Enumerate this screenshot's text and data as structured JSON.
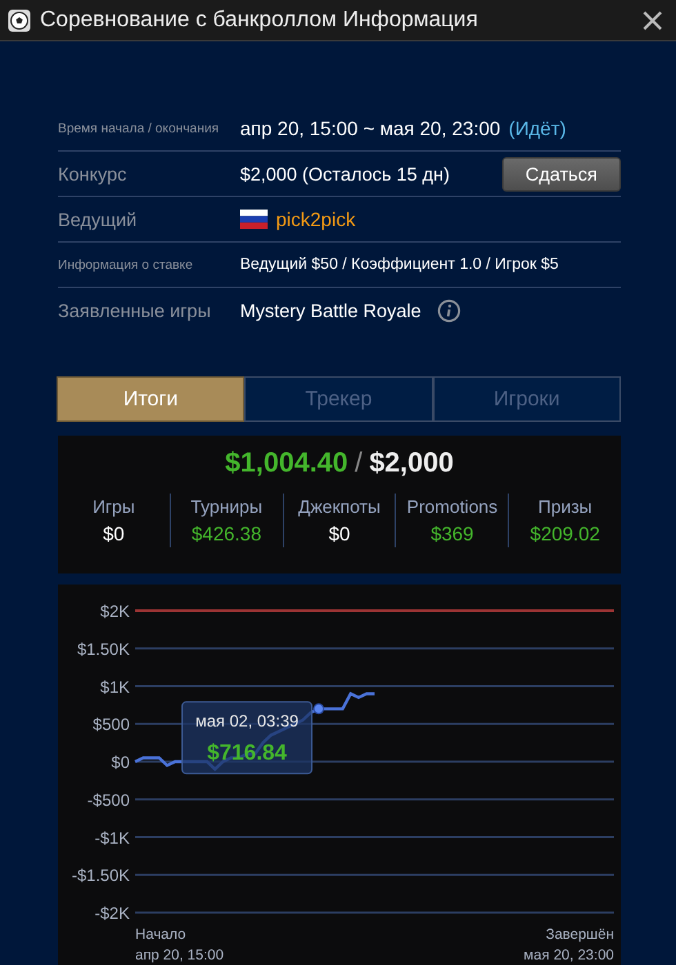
{
  "window": {
    "title": "Соревнование с банкроллом Информация"
  },
  "info": [
    {
      "kind": "time",
      "label": "Время начала / окончания",
      "value": "апр 20, 15:00 ~ мая 20, 23:00",
      "status": "(Идёт)"
    },
    {
      "kind": "prize",
      "label": "Конкурс",
      "value": "$2,000 (Осталось 15 дн)",
      "button": "Сдаться"
    },
    {
      "kind": "host",
      "label": "Ведущий",
      "value": "pick2pick"
    },
    {
      "kind": "text",
      "label": "Информация о ставке",
      "value": "Ведущий $50 / Коэффициент 1.0 / Игрок $5"
    },
    {
      "kind": "games",
      "label": "Заявленные игры",
      "value": "Mystery Battle Royale"
    }
  ],
  "tabs": [
    {
      "label": "Итоги",
      "selected": true
    },
    {
      "label": "Трекер",
      "selected": false
    },
    {
      "label": "Игроки",
      "selected": false
    }
  ],
  "summary": {
    "current": "$1,004.40",
    "separator": "/",
    "target": "$2,000",
    "stats": [
      {
        "label": "Игры",
        "value": "$0",
        "color": "#ffffff"
      },
      {
        "label": "Турниры",
        "value": "$426.38",
        "color": "#44b62c"
      },
      {
        "label": "Джекпоты",
        "value": "$0",
        "color": "#ffffff"
      },
      {
        "label": "Promotions",
        "value": "$369",
        "color": "#44b62c"
      },
      {
        "label": "Призы",
        "value": "$209.02",
        "color": "#44b62c"
      }
    ]
  },
  "chart": {
    "chart_data": {
      "type": "line",
      "ylim": [
        -2000,
        2000
      ],
      "yticks": [
        {
          "value": 2000,
          "label": "$2K"
        },
        {
          "value": 1500,
          "label": "$1.50K"
        },
        {
          "value": 1000,
          "label": "$1K"
        },
        {
          "value": 500,
          "label": "$500"
        },
        {
          "value": 0,
          "label": "$0"
        },
        {
          "value": -500,
          "label": "-$500"
        },
        {
          "value": -1000,
          "label": "-$1K"
        },
        {
          "value": -1500,
          "label": "-$1.50K"
        },
        {
          "value": -2000,
          "label": "-$2K"
        }
      ],
      "grid": true,
      "categories": [
        null,
        null,
        null,
        null,
        null,
        null,
        null,
        null,
        null,
        null,
        null,
        null,
        null,
        null,
        null,
        null,
        null,
        null,
        null,
        null,
        null,
        null,
        null,
        null,
        null,
        null,
        null,
        null,
        null,
        null,
        null,
        null,
        null,
        null,
        null,
        null,
        null,
        null,
        null,
        null,
        null,
        null,
        null,
        null,
        null,
        null,
        null,
        null,
        null,
        null,
        null,
        null,
        null,
        null,
        null,
        null,
        null,
        null,
        null,
        null,
        null
      ],
      "series": [
        {
          "color": "#4a72d8",
          "values": [
            0,
            50,
            50,
            50,
            -50,
            0,
            0,
            0,
            0,
            0,
            -100,
            0,
            50,
            50,
            100,
            100,
            250,
            350,
            400,
            450,
            500,
            550,
            650,
            700,
            700,
            700,
            700,
            900,
            850,
            900,
            900,
            null,
            null,
            null,
            null,
            null,
            null,
            null,
            null,
            null,
            null,
            null,
            null,
            null,
            null,
            null,
            null,
            null,
            null,
            null,
            null,
            null,
            null,
            null,
            null,
            null,
            null,
            null,
            null,
            null,
            null
          ]
        }
      ]
    },
    "tooltip": {
      "date": "мая 02, 03:39",
      "value": "$716.84"
    },
    "start": {
      "caption": "Начало",
      "date": "апр 20, 15:00"
    },
    "end": {
      "caption": "Завершён",
      "date": "мая 20, 23:00"
    }
  }
}
